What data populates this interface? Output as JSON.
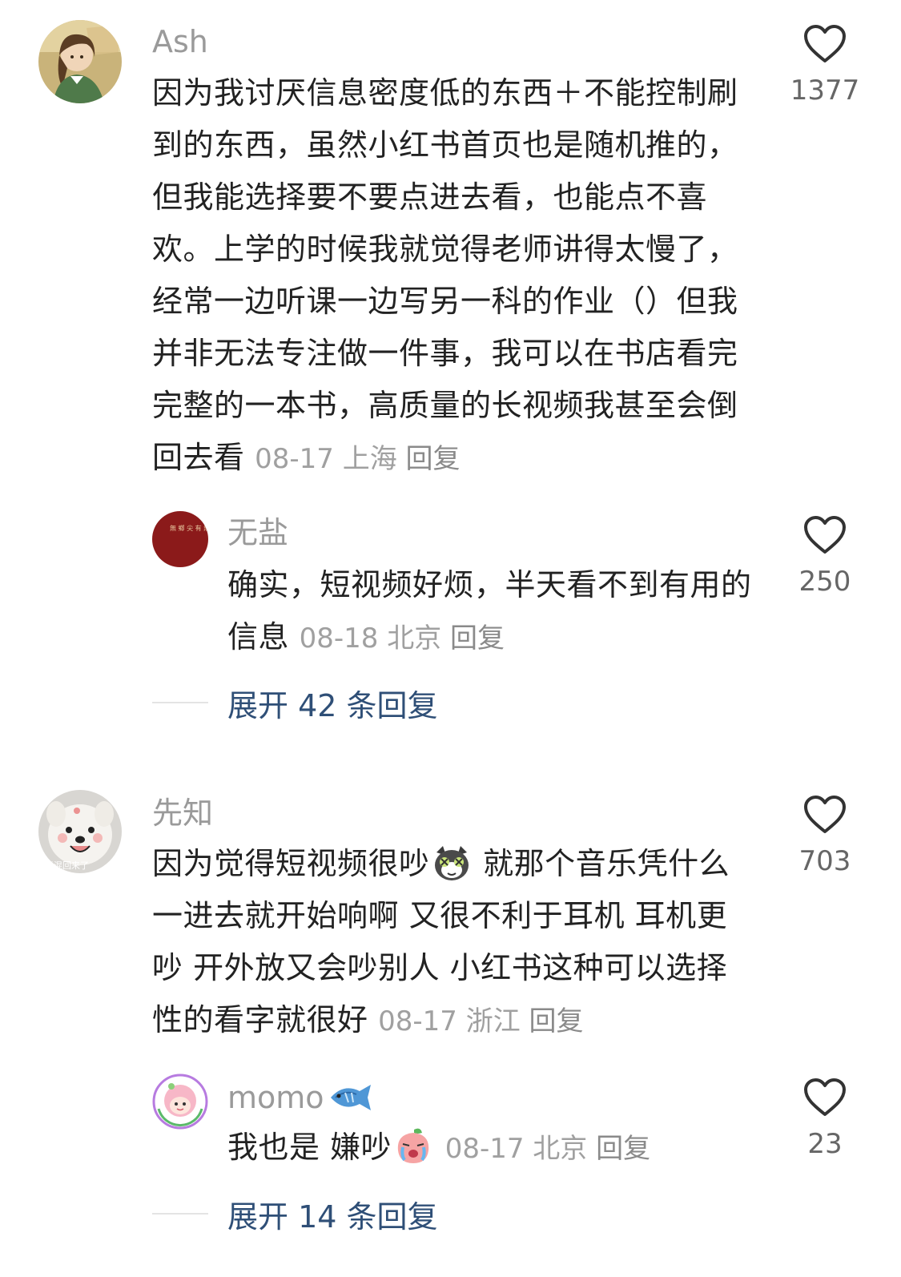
{
  "comments": [
    {
      "username": "Ash",
      "text": "因为我讨厌信息密度低的东西＋不能控制刷到的东西，虽然小红书首页也是随机推的，但我能选择要不要点进去看，也能点不喜欢。上学的时候我就觉得老师讲得太慢了，经常一边听课一边写另一科的作业（）但我并非无法专注做一件事，我可以在书店看完完整的一本书，高质量的长视频我甚至会倒回去看",
      "date": "08-17",
      "location": "上海",
      "reply_label": "回复",
      "likes": "1377",
      "avatar_icon": "anime-girl-avatar"
    },
    {
      "username": "无盐",
      "text": "确实，短视频好烦，半天看不到有用的信息",
      "date": "08-18",
      "location": "北京",
      "reply_label": "回复",
      "likes": "250",
      "avatar_icon": "red-calligraphy-avatar",
      "avatar_text": "無 鄉 尖 有 無 鄕 酸"
    },
    {
      "expand_label": "展开 42 条回复"
    },
    {
      "username": "先知",
      "text_before_emoji": "因为觉得短视频很吵",
      "text_after_emoji": " 就那个音乐凭什么一进去就开始响啊 又很不利于耳机 耳机更吵 开外放又会吵别人 小红书这种可以选择性的看字就很好",
      "emoji_icon": "cat-dizzy-emoji",
      "date": "08-17",
      "location": "浙江",
      "reply_label": "回复",
      "likes": "703",
      "avatar_icon": "samoyed-dog-avatar",
      "avatar_text": "青混回来了"
    },
    {
      "username": "momo",
      "username_emoji": "fish-emoji",
      "text_before_emoji": "我也是 嫌吵",
      "emoji_icon": "crying-peach-emoji",
      "date": "08-17",
      "location": "北京",
      "reply_label": "回复",
      "likes": "23",
      "avatar_icon": "pink-hair-girl-avatar"
    },
    {
      "expand_label": "展开 14 条回复"
    }
  ],
  "colors": {
    "expand_text": "#2f4f77",
    "meta_text": "#a0a0a0",
    "username": "#9a9a9a",
    "heart_stroke": "#333333"
  }
}
